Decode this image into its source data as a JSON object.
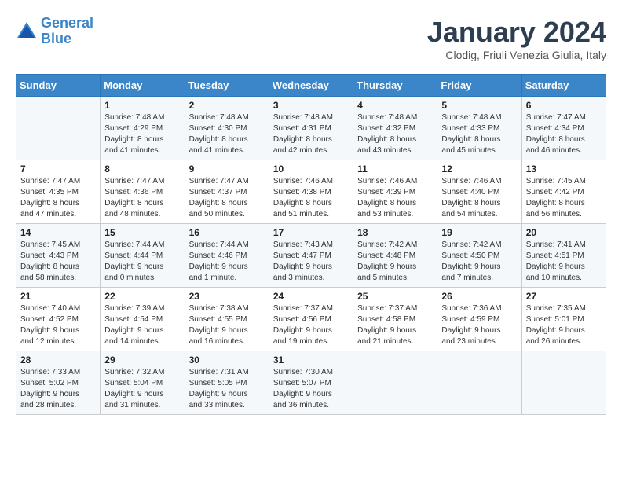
{
  "header": {
    "logo_line1": "General",
    "logo_line2": "Blue",
    "month": "January 2024",
    "location": "Clodig, Friuli Venezia Giulia, Italy"
  },
  "weekdays": [
    "Sunday",
    "Monday",
    "Tuesday",
    "Wednesday",
    "Thursday",
    "Friday",
    "Saturday"
  ],
  "weeks": [
    [
      {
        "day": "",
        "info": ""
      },
      {
        "day": "1",
        "info": "Sunrise: 7:48 AM\nSunset: 4:29 PM\nDaylight: 8 hours\nand 41 minutes."
      },
      {
        "day": "2",
        "info": "Sunrise: 7:48 AM\nSunset: 4:30 PM\nDaylight: 8 hours\nand 41 minutes."
      },
      {
        "day": "3",
        "info": "Sunrise: 7:48 AM\nSunset: 4:31 PM\nDaylight: 8 hours\nand 42 minutes."
      },
      {
        "day": "4",
        "info": "Sunrise: 7:48 AM\nSunset: 4:32 PM\nDaylight: 8 hours\nand 43 minutes."
      },
      {
        "day": "5",
        "info": "Sunrise: 7:48 AM\nSunset: 4:33 PM\nDaylight: 8 hours\nand 45 minutes."
      },
      {
        "day": "6",
        "info": "Sunrise: 7:47 AM\nSunset: 4:34 PM\nDaylight: 8 hours\nand 46 minutes."
      }
    ],
    [
      {
        "day": "7",
        "info": "Sunrise: 7:47 AM\nSunset: 4:35 PM\nDaylight: 8 hours\nand 47 minutes."
      },
      {
        "day": "8",
        "info": "Sunrise: 7:47 AM\nSunset: 4:36 PM\nDaylight: 8 hours\nand 48 minutes."
      },
      {
        "day": "9",
        "info": "Sunrise: 7:47 AM\nSunset: 4:37 PM\nDaylight: 8 hours\nand 50 minutes."
      },
      {
        "day": "10",
        "info": "Sunrise: 7:46 AM\nSunset: 4:38 PM\nDaylight: 8 hours\nand 51 minutes."
      },
      {
        "day": "11",
        "info": "Sunrise: 7:46 AM\nSunset: 4:39 PM\nDaylight: 8 hours\nand 53 minutes."
      },
      {
        "day": "12",
        "info": "Sunrise: 7:46 AM\nSunset: 4:40 PM\nDaylight: 8 hours\nand 54 minutes."
      },
      {
        "day": "13",
        "info": "Sunrise: 7:45 AM\nSunset: 4:42 PM\nDaylight: 8 hours\nand 56 minutes."
      }
    ],
    [
      {
        "day": "14",
        "info": "Sunrise: 7:45 AM\nSunset: 4:43 PM\nDaylight: 8 hours\nand 58 minutes."
      },
      {
        "day": "15",
        "info": "Sunrise: 7:44 AM\nSunset: 4:44 PM\nDaylight: 9 hours\nand 0 minutes."
      },
      {
        "day": "16",
        "info": "Sunrise: 7:44 AM\nSunset: 4:46 PM\nDaylight: 9 hours\nand 1 minute."
      },
      {
        "day": "17",
        "info": "Sunrise: 7:43 AM\nSunset: 4:47 PM\nDaylight: 9 hours\nand 3 minutes."
      },
      {
        "day": "18",
        "info": "Sunrise: 7:42 AM\nSunset: 4:48 PM\nDaylight: 9 hours\nand 5 minutes."
      },
      {
        "day": "19",
        "info": "Sunrise: 7:42 AM\nSunset: 4:50 PM\nDaylight: 9 hours\nand 7 minutes."
      },
      {
        "day": "20",
        "info": "Sunrise: 7:41 AM\nSunset: 4:51 PM\nDaylight: 9 hours\nand 10 minutes."
      }
    ],
    [
      {
        "day": "21",
        "info": "Sunrise: 7:40 AM\nSunset: 4:52 PM\nDaylight: 9 hours\nand 12 minutes."
      },
      {
        "day": "22",
        "info": "Sunrise: 7:39 AM\nSunset: 4:54 PM\nDaylight: 9 hours\nand 14 minutes."
      },
      {
        "day": "23",
        "info": "Sunrise: 7:38 AM\nSunset: 4:55 PM\nDaylight: 9 hours\nand 16 minutes."
      },
      {
        "day": "24",
        "info": "Sunrise: 7:37 AM\nSunset: 4:56 PM\nDaylight: 9 hours\nand 19 minutes."
      },
      {
        "day": "25",
        "info": "Sunrise: 7:37 AM\nSunset: 4:58 PM\nDaylight: 9 hours\nand 21 minutes."
      },
      {
        "day": "26",
        "info": "Sunrise: 7:36 AM\nSunset: 4:59 PM\nDaylight: 9 hours\nand 23 minutes."
      },
      {
        "day": "27",
        "info": "Sunrise: 7:35 AM\nSunset: 5:01 PM\nDaylight: 9 hours\nand 26 minutes."
      }
    ],
    [
      {
        "day": "28",
        "info": "Sunrise: 7:33 AM\nSunset: 5:02 PM\nDaylight: 9 hours\nand 28 minutes."
      },
      {
        "day": "29",
        "info": "Sunrise: 7:32 AM\nSunset: 5:04 PM\nDaylight: 9 hours\nand 31 minutes."
      },
      {
        "day": "30",
        "info": "Sunrise: 7:31 AM\nSunset: 5:05 PM\nDaylight: 9 hours\nand 33 minutes."
      },
      {
        "day": "31",
        "info": "Sunrise: 7:30 AM\nSunset: 5:07 PM\nDaylight: 9 hours\nand 36 minutes."
      },
      {
        "day": "",
        "info": ""
      },
      {
        "day": "",
        "info": ""
      },
      {
        "day": "",
        "info": ""
      }
    ]
  ]
}
